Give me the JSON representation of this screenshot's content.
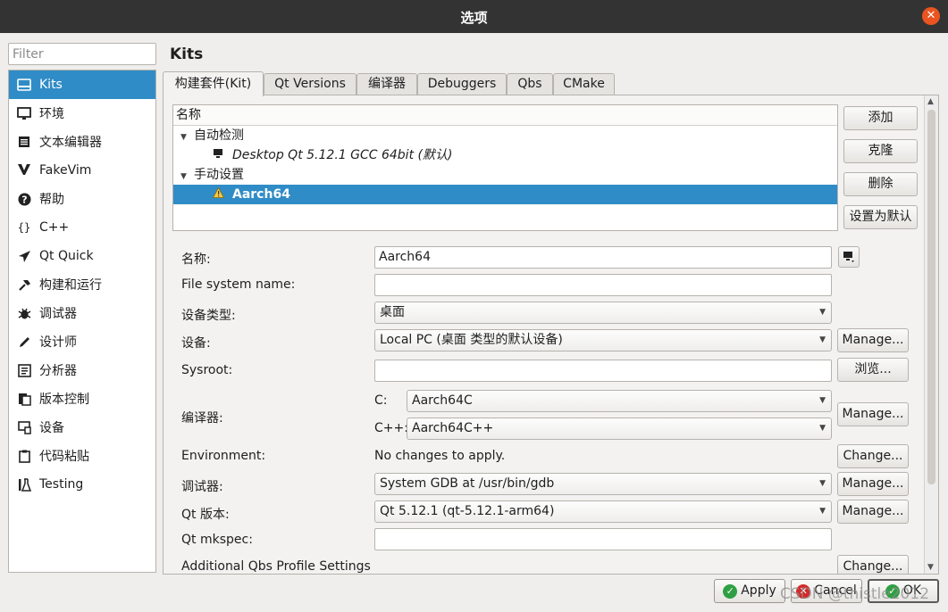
{
  "window": {
    "title": "选项",
    "close_glyph": "✕"
  },
  "filter": {
    "placeholder": "Filter",
    "value": ""
  },
  "sidebar": {
    "items": [
      {
        "label": "Kits",
        "icon": "kits-icon",
        "selected": true
      },
      {
        "label": "环境",
        "icon": "monitor-icon"
      },
      {
        "label": "文本编辑器",
        "icon": "text-editor-icon"
      },
      {
        "label": "FakeVim",
        "icon": "fakevim-icon"
      },
      {
        "label": "帮助",
        "icon": "help-icon"
      },
      {
        "label": "C++",
        "icon": "braces-icon"
      },
      {
        "label": "Qt Quick",
        "icon": "paper-plane-icon"
      },
      {
        "label": "构建和运行",
        "icon": "hammer-icon"
      },
      {
        "label": "调试器",
        "icon": "bug-icon"
      },
      {
        "label": "设计师",
        "icon": "pencil-icon"
      },
      {
        "label": "分析器",
        "icon": "analyzer-icon"
      },
      {
        "label": "版本控制",
        "icon": "version-control-icon"
      },
      {
        "label": "设备",
        "icon": "device-icon"
      },
      {
        "label": "代码粘贴",
        "icon": "paste-icon"
      },
      {
        "label": "Testing",
        "icon": "flask-icon"
      }
    ]
  },
  "page": {
    "heading": "Kits"
  },
  "tabs": [
    {
      "label": "构建套件(Kit)",
      "active": true
    },
    {
      "label": "Qt Versions"
    },
    {
      "label": "编译器"
    },
    {
      "label": "Debuggers"
    },
    {
      "label": "Qbs"
    },
    {
      "label": "CMake"
    }
  ],
  "kit_tree": {
    "header": "名称",
    "auto_group": "自动检测",
    "auto_kit": "Desktop Qt 5.12.1 GCC 64bit (默认)",
    "manual_group": "手动设置",
    "manual_kit": "Aarch64"
  },
  "kit_buttons": {
    "add": "添加",
    "clone": "克隆",
    "remove": "删除",
    "make_default": "设置为默认"
  },
  "form": {
    "name_label": "名称:",
    "name_value": "Aarch64",
    "fs_label": "File system name:",
    "fs_value": "",
    "device_type_label": "设备类型:",
    "device_type_value": "桌面",
    "device_label": "设备:",
    "device_value": "Local PC (桌面 类型的默认设备)",
    "device_manage": "Manage...",
    "sysroot_label": "Sysroot:",
    "sysroot_value": "",
    "sysroot_browse": "浏览...",
    "compiler_label": "编译器:",
    "c_label": "C:",
    "c_value": "Aarch64C",
    "cpp_label": "C++:",
    "cpp_value": "Aarch64C++",
    "compiler_manage": "Manage...",
    "env_label": "Environment:",
    "env_value": "No changes to apply.",
    "env_change": "Change...",
    "debugger_label": "调试器:",
    "debugger_value": "System GDB at /usr/bin/gdb",
    "debugger_manage": "Manage...",
    "qt_label": "Qt 版本:",
    "qt_value": "Qt 5.12.1 (qt-5.12.1-arm64)",
    "qt_manage": "Manage...",
    "mkspec_label": "Qt mkspec:",
    "mkspec_value": "",
    "qbs_label": "Additional Qbs Profile Settings",
    "qbs_change": "Change..."
  },
  "dialog_buttons": {
    "apply": "Apply",
    "cancel": "Cancel",
    "ok": "OK"
  },
  "watermark": "CSDN @thistle2012",
  "colors": {
    "selection": "#308cc6",
    "titlebar": "#333333",
    "close": "#e95420"
  }
}
